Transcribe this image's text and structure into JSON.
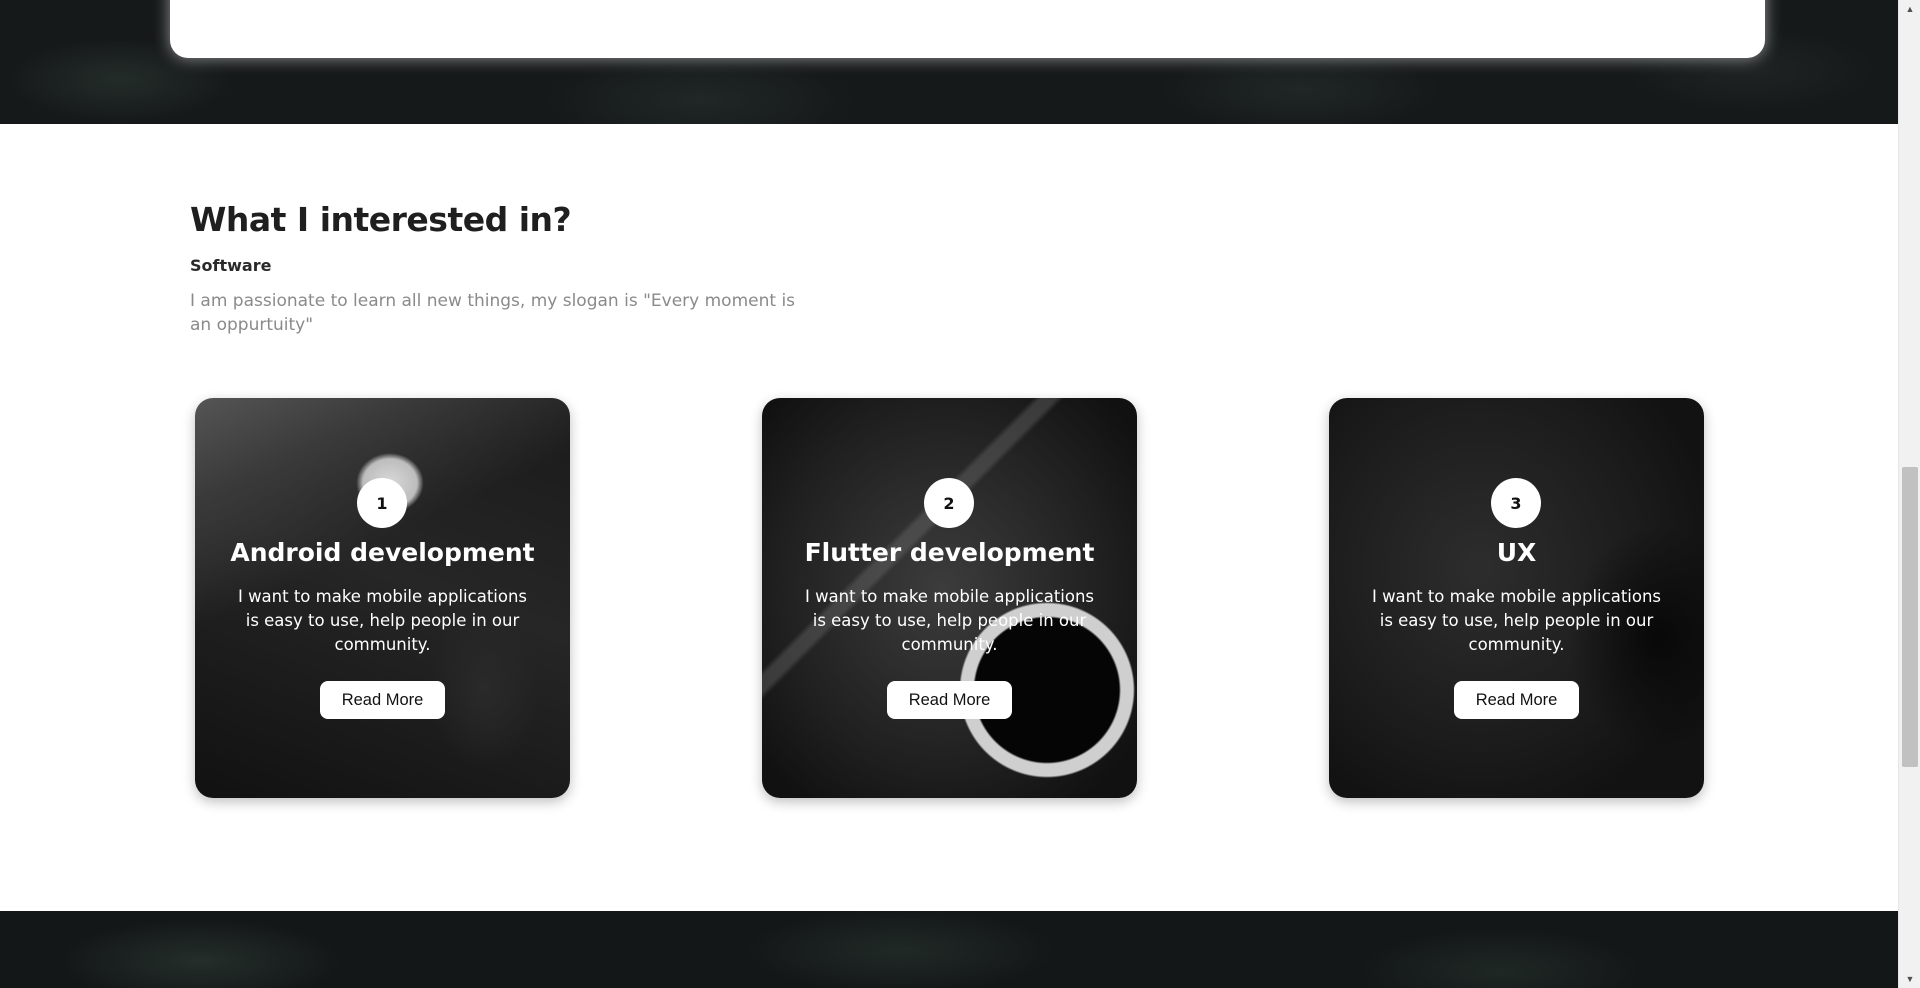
{
  "section": {
    "title": "What I interested in?",
    "subtitle": "Software",
    "description": "I am passionate to learn all new things, my slogan is \"Every moment is an oppurtuity\""
  },
  "cards": [
    {
      "number": "1",
      "title": "Android development",
      "text": "I want to make mobile applications is easy to use, help people in our community.",
      "button_label": "Read More"
    },
    {
      "number": "2",
      "title": "Flutter development",
      "text": "I want to make mobile applications is easy to use, help people in our community.",
      "button_label": "Read More"
    },
    {
      "number": "3",
      "title": "UX",
      "text": "I want to make mobile applications is easy to use, help people in our community.",
      "button_label": "Read More"
    }
  ],
  "scrollbar": {
    "up_icon": "triangle-up-icon",
    "down_icon": "triangle-down-icon"
  },
  "colors": {
    "page_background": "#ffffff",
    "dark_band": "#16191a",
    "heading_text": "#1f1f1f",
    "muted_text": "#8a8a8a",
    "card_text": "#ffffff"
  }
}
